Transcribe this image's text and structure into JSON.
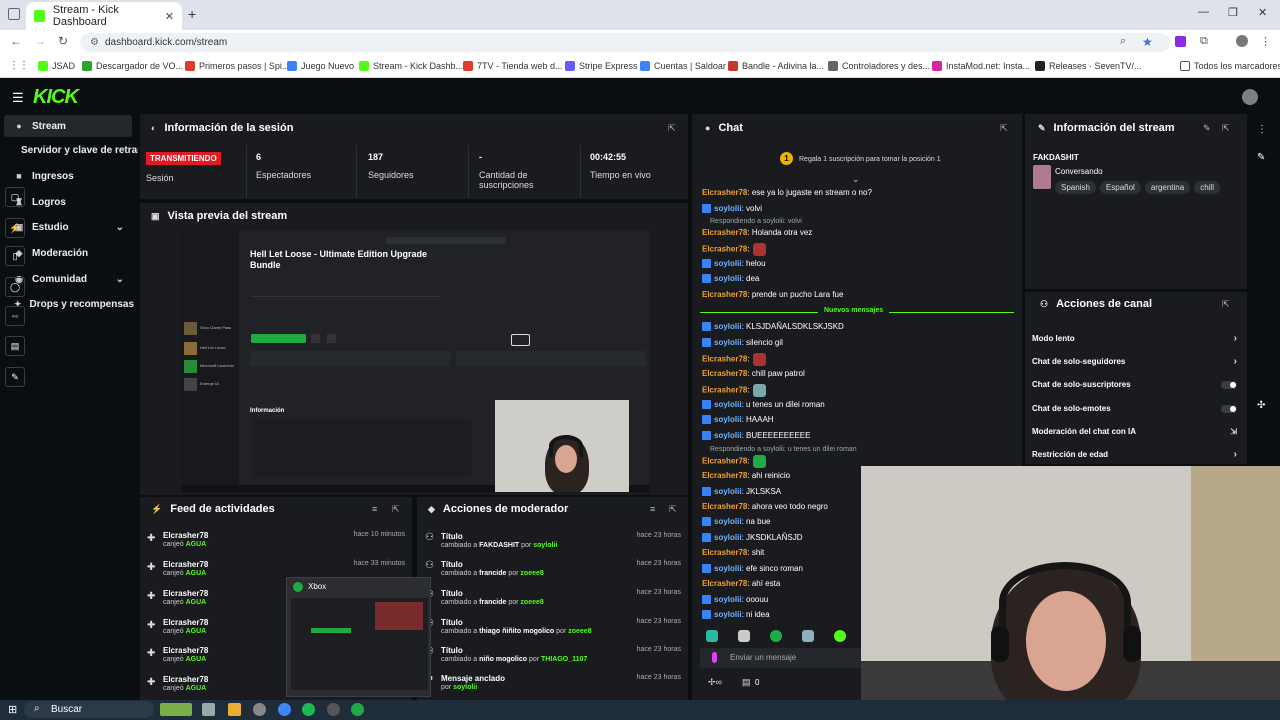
{
  "browser": {
    "tab_title": "Stream - Kick Dashboard",
    "url": "dashboard.kick.com/stream",
    "bookmarks": [
      "JSAD",
      "Descargador de VO...",
      "Primeros pasos | Spi...",
      "Juego Nuevo",
      "Stream - Kick Dashb...",
      "7TV - Tienda web d...",
      "Stripe Express",
      "Cuentas | Saldoar",
      "Bandle - Adivina la...",
      "Controladores y des...",
      "InstaMod.net: Insta...",
      "Releases · SevenTV/..."
    ],
    "bookmarks_all": "Todos los marcadores"
  },
  "brand": "KICK",
  "sidebar": {
    "items": [
      {
        "label": "Stream"
      },
      {
        "label": "Servidor y clave de retransmisión"
      },
      {
        "label": "Ingresos"
      },
      {
        "label": "Logros"
      },
      {
        "label": "Estudio"
      },
      {
        "label": "Moderación"
      },
      {
        "label": "Comunidad"
      },
      {
        "label": "Drops y recompensas"
      }
    ]
  },
  "session": {
    "title": "Información de la sesión",
    "live": "TRANSMITIENDO",
    "session_label": "Sesión",
    "stats": [
      {
        "value": "6",
        "label": "Espectadores"
      },
      {
        "value": "187",
        "label": "Seguidores"
      },
      {
        "value": "-",
        "label": "Cantidad de suscripciones"
      },
      {
        "value": "00:42:55",
        "label": "Tiempo en vivo"
      }
    ]
  },
  "preview": {
    "title": "Vista previa del stream",
    "game_title": "Hell Let Loose - Ultimate Edition Upgrade Bundle",
    "info": "Información",
    "side_items": [
      "Xbox Game Pass",
      "Hell Let Loose",
      "Microsoft Launcher",
      "Emerge IA"
    ]
  },
  "feed": {
    "title": "Feed de actividades",
    "rows": [
      {
        "user": "Elcrasher78",
        "desc": "canjeó",
        "item": "AGUA",
        "time": "hace 10 minutos"
      },
      {
        "user": "Elcrasher78",
        "desc": "canjeó",
        "item": "AGUA",
        "time": "hace 33 minutos"
      },
      {
        "user": "Elcrasher78",
        "desc": "canjeó",
        "item": "AGUA",
        "time": ""
      },
      {
        "user": "Elcrasher78",
        "desc": "canjeó",
        "item": "AGUA",
        "time": ""
      },
      {
        "user": "Elcrasher78",
        "desc": "canjeó",
        "item": "AGUA",
        "time": ""
      },
      {
        "user": "Elcrasher78",
        "desc": "canjeó",
        "item": "AGUA",
        "time": ""
      }
    ]
  },
  "xbox_popup": {
    "title": "Xbox"
  },
  "mod": {
    "title": "Acciones de moderador",
    "rows": [
      {
        "title": "Título",
        "desc": "cambiado a",
        "to": "FAKDASHIT",
        "by_word": "por",
        "by": "soylolii",
        "time": "hace 23 horas"
      },
      {
        "title": "Título",
        "desc": "cambiado a",
        "to": "francide",
        "by_word": "por",
        "by": "zoeee8",
        "time": "hace 23 horas"
      },
      {
        "title": "Título",
        "desc": "cambiado a",
        "to": "francide",
        "by_word": "por",
        "by": "zoeee8",
        "time": "hace 23 horas"
      },
      {
        "title": "Título",
        "desc": "cambiado a",
        "to": "thiago ñiñito mogolico",
        "by_word": "por",
        "by": "zoeee8",
        "time": "hace 23 horas"
      },
      {
        "title": "Título",
        "desc": "cambiado a",
        "to": "niño mogolico",
        "by_word": "por",
        "by": "THIAGO_1107",
        "time": "hace 23 horas"
      },
      {
        "title": "Mensaje anclado",
        "desc": "",
        "to": "",
        "by_word": "por",
        "by": "soylolii",
        "time": "hace 23 horas"
      }
    ]
  },
  "chat": {
    "title": "Chat",
    "gift": "Regala 1 suscripción para tomar la posición 1",
    "new_messages": "Nuevos mensajes",
    "input_placeholder": "Enviar un mensaje",
    "counter": "0",
    "messages": [
      {
        "user": "Elcrasher78",
        "text": ": ese ya lo jugaste en stream o no?",
        "type": "orange"
      },
      {
        "user": "soylolii",
        "text": ": volvi",
        "type": "blue"
      },
      {
        "reply": "Respondiendo a soylolii: volvi"
      },
      {
        "user": "Elcrasher78",
        "text": ": Holanda otra vez",
        "type": "orange"
      },
      {
        "user": "Elcrasher78",
        "text": ":",
        "type": "orange",
        "emote": true
      },
      {
        "user": "soylolii",
        "text": ": helou",
        "type": "blue"
      },
      {
        "user": "soylolii",
        "text": ": dea",
        "type": "blue"
      },
      {
        "user": "Elcrasher78",
        "text": ": prende un pucho Lara fue",
        "type": "orange"
      },
      {
        "user": "soylolii",
        "text": ": KLSJDAÑALSDKLSKJSKD",
        "type": "blue"
      },
      {
        "user": "soylolii",
        "text": ": silencio gil",
        "type": "blue"
      },
      {
        "user": "Elcrasher78",
        "text": ":",
        "type": "orange",
        "emote": true
      },
      {
        "user": "Elcrasher78",
        "text": ": chill paw patrol",
        "type": "orange"
      },
      {
        "user": "Elcrasher78",
        "text": ":",
        "type": "orange",
        "emote": true
      },
      {
        "user": "soylolii",
        "text": ": u tenes un dilei roman",
        "type": "blue"
      },
      {
        "user": "soylolii",
        "text": ": HAAAH",
        "type": "blue"
      },
      {
        "user": "soylolii",
        "text": ": BUEEEEEEEEEE",
        "type": "blue"
      },
      {
        "reply": "Respondiendo a soylolii: u tenes un dilei roman"
      },
      {
        "user": "Elcrasher78",
        "text": ":",
        "type": "orange",
        "emote": true
      },
      {
        "user": "Elcrasher78",
        "text": ": ahi reinicio",
        "type": "orange"
      },
      {
        "user": "soylolii",
        "text": ": JKLSKSA",
        "type": "blue"
      },
      {
        "user": "Elcrasher78",
        "text": ": ahora veo todo negro",
        "type": "orange"
      },
      {
        "user": "soylolii",
        "text": ": na bue",
        "type": "blue"
      },
      {
        "user": "soylolii",
        "text": ": JKSDKLAÑSJD",
        "type": "blue"
      },
      {
        "user": "Elcrasher78",
        "text": ": shit",
        "type": "orange"
      },
      {
        "user": "soylolii",
        "text": ": efe sinco roman",
        "type": "blue"
      },
      {
        "user": "Elcrasher78",
        "text": ": ahí esta",
        "type": "orange"
      },
      {
        "user": "soylolii",
        "text": ": ooouu",
        "type": "blue"
      },
      {
        "user": "soylolii",
        "text": ": ni idea",
        "type": "blue"
      }
    ]
  },
  "stream_info": {
    "title": "Información del stream",
    "name": "FAKDASHIT",
    "category": "Conversando",
    "tags": [
      "Spanish",
      "Español",
      "argentina",
      "chill"
    ]
  },
  "channel": {
    "title": "Acciones de canal",
    "actions": [
      {
        "label": "Modo lento",
        "control": "arrow"
      },
      {
        "label": "Chat de solo-seguidores",
        "control": "arrow"
      },
      {
        "label": "Chat de solo-suscriptores",
        "control": "toggle"
      },
      {
        "label": "Chat de solo-emotes",
        "control": "toggle"
      },
      {
        "label": "Moderación del chat con IA",
        "control": "external"
      },
      {
        "label": "Restricción de edad",
        "control": "arrow"
      }
    ]
  },
  "taskbar": {
    "search": "Buscar"
  },
  "colors": {
    "kick_green": "#53fc18",
    "panel": "#191b1f",
    "bg": "#0b0e11",
    "user_orange": "#f0a030",
    "user_blue": "#6cb4ff",
    "live_red": "#e01b24"
  }
}
